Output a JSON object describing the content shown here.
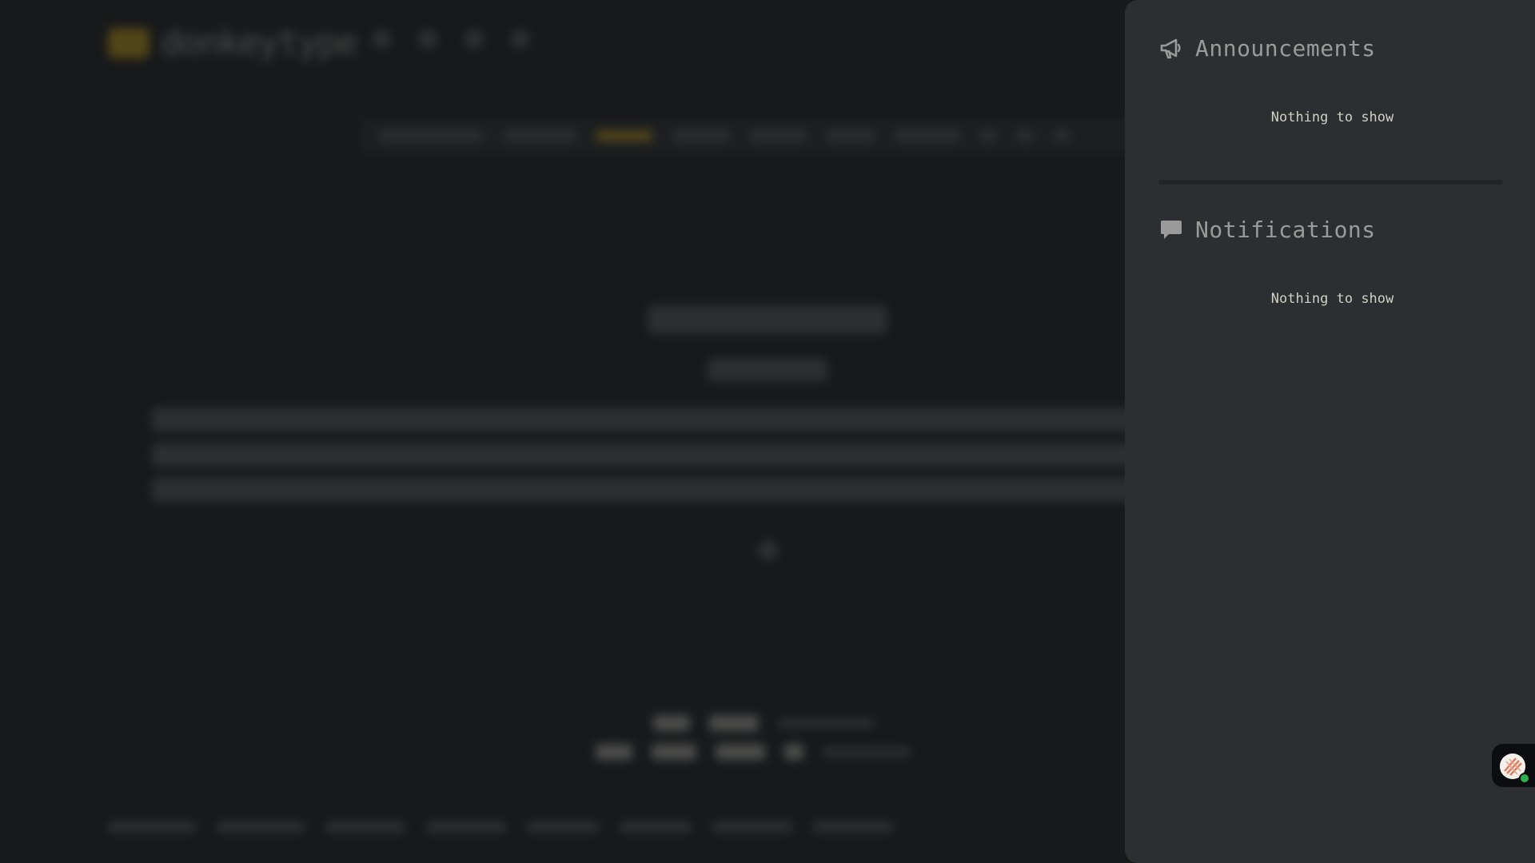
{
  "background_app": {
    "brand": "donkeytype"
  },
  "panel": {
    "announcements": {
      "title": "Announcements",
      "icon": "megaphone-icon",
      "empty_text": "Nothing to show"
    },
    "notifications": {
      "title": "Notifications",
      "icon": "comment-icon",
      "empty_text": "Nothing to show"
    }
  },
  "colors": {
    "page_bg": "#18191b",
    "panel_bg": "#2c2e31",
    "accent": "#e2b714",
    "muted_text": "#9a9a9a",
    "main_text": "#d1d0c5",
    "online_status": "#2bb24c"
  }
}
